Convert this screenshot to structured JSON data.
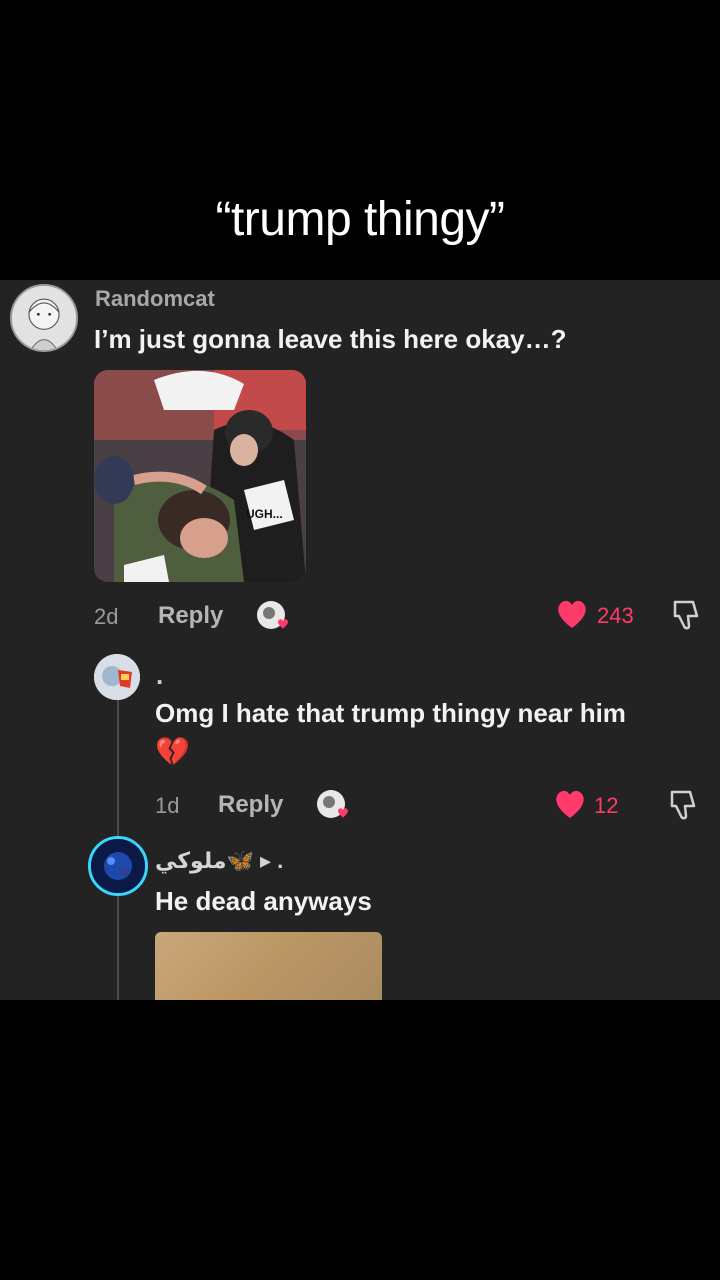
{
  "caption": "“trump thingy”",
  "comment": {
    "username": "Randomcat",
    "text": "I’m just gonna leave this here okay…?",
    "image_text": "UGH...",
    "age": "2d",
    "reply_label": "Reply",
    "likes": "243"
  },
  "reply1": {
    "username": ".",
    "text": "Omg I hate that trump thingy near him",
    "emoji": "💔",
    "age": "1d",
    "reply_label": "Reply",
    "likes": "12"
  },
  "reply2": {
    "username": "ملوكي🦋 ▸ .",
    "text": "He dead anyways"
  },
  "colors": {
    "like": "#ff3b6b",
    "panel": "#232323",
    "ring": "#3ad6ff"
  }
}
